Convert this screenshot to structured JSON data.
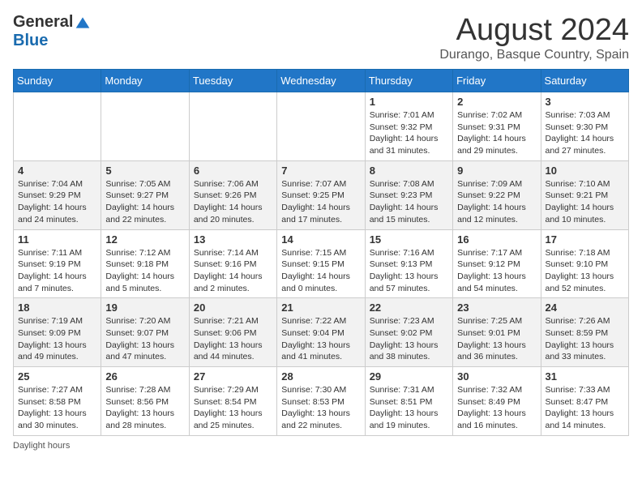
{
  "logo": {
    "general": "General",
    "blue": "Blue"
  },
  "title": "August 2024",
  "location": "Durango, Basque Country, Spain",
  "days_of_week": [
    "Sunday",
    "Monday",
    "Tuesday",
    "Wednesday",
    "Thursday",
    "Friday",
    "Saturday"
  ],
  "footer_note": "Daylight hours",
  "weeks": [
    [
      {
        "day": "",
        "detail": ""
      },
      {
        "day": "",
        "detail": ""
      },
      {
        "day": "",
        "detail": ""
      },
      {
        "day": "",
        "detail": ""
      },
      {
        "day": "1",
        "detail": "Sunrise: 7:01 AM\nSunset: 9:32 PM\nDaylight: 14 hours\nand 31 minutes."
      },
      {
        "day": "2",
        "detail": "Sunrise: 7:02 AM\nSunset: 9:31 PM\nDaylight: 14 hours\nand 29 minutes."
      },
      {
        "day": "3",
        "detail": "Sunrise: 7:03 AM\nSunset: 9:30 PM\nDaylight: 14 hours\nand 27 minutes."
      }
    ],
    [
      {
        "day": "4",
        "detail": "Sunrise: 7:04 AM\nSunset: 9:29 PM\nDaylight: 14 hours\nand 24 minutes."
      },
      {
        "day": "5",
        "detail": "Sunrise: 7:05 AM\nSunset: 9:27 PM\nDaylight: 14 hours\nand 22 minutes."
      },
      {
        "day": "6",
        "detail": "Sunrise: 7:06 AM\nSunset: 9:26 PM\nDaylight: 14 hours\nand 20 minutes."
      },
      {
        "day": "7",
        "detail": "Sunrise: 7:07 AM\nSunset: 9:25 PM\nDaylight: 14 hours\nand 17 minutes."
      },
      {
        "day": "8",
        "detail": "Sunrise: 7:08 AM\nSunset: 9:23 PM\nDaylight: 14 hours\nand 15 minutes."
      },
      {
        "day": "9",
        "detail": "Sunrise: 7:09 AM\nSunset: 9:22 PM\nDaylight: 14 hours\nand 12 minutes."
      },
      {
        "day": "10",
        "detail": "Sunrise: 7:10 AM\nSunset: 9:21 PM\nDaylight: 14 hours\nand 10 minutes."
      }
    ],
    [
      {
        "day": "11",
        "detail": "Sunrise: 7:11 AM\nSunset: 9:19 PM\nDaylight: 14 hours\nand 7 minutes."
      },
      {
        "day": "12",
        "detail": "Sunrise: 7:12 AM\nSunset: 9:18 PM\nDaylight: 14 hours\nand 5 minutes."
      },
      {
        "day": "13",
        "detail": "Sunrise: 7:14 AM\nSunset: 9:16 PM\nDaylight: 14 hours\nand 2 minutes."
      },
      {
        "day": "14",
        "detail": "Sunrise: 7:15 AM\nSunset: 9:15 PM\nDaylight: 14 hours\nand 0 minutes."
      },
      {
        "day": "15",
        "detail": "Sunrise: 7:16 AM\nSunset: 9:13 PM\nDaylight: 13 hours\nand 57 minutes."
      },
      {
        "day": "16",
        "detail": "Sunrise: 7:17 AM\nSunset: 9:12 PM\nDaylight: 13 hours\nand 54 minutes."
      },
      {
        "day": "17",
        "detail": "Sunrise: 7:18 AM\nSunset: 9:10 PM\nDaylight: 13 hours\nand 52 minutes."
      }
    ],
    [
      {
        "day": "18",
        "detail": "Sunrise: 7:19 AM\nSunset: 9:09 PM\nDaylight: 13 hours\nand 49 minutes."
      },
      {
        "day": "19",
        "detail": "Sunrise: 7:20 AM\nSunset: 9:07 PM\nDaylight: 13 hours\nand 47 minutes."
      },
      {
        "day": "20",
        "detail": "Sunrise: 7:21 AM\nSunset: 9:06 PM\nDaylight: 13 hours\nand 44 minutes."
      },
      {
        "day": "21",
        "detail": "Sunrise: 7:22 AM\nSunset: 9:04 PM\nDaylight: 13 hours\nand 41 minutes."
      },
      {
        "day": "22",
        "detail": "Sunrise: 7:23 AM\nSunset: 9:02 PM\nDaylight: 13 hours\nand 38 minutes."
      },
      {
        "day": "23",
        "detail": "Sunrise: 7:25 AM\nSunset: 9:01 PM\nDaylight: 13 hours\nand 36 minutes."
      },
      {
        "day": "24",
        "detail": "Sunrise: 7:26 AM\nSunset: 8:59 PM\nDaylight: 13 hours\nand 33 minutes."
      }
    ],
    [
      {
        "day": "25",
        "detail": "Sunrise: 7:27 AM\nSunset: 8:58 PM\nDaylight: 13 hours\nand 30 minutes."
      },
      {
        "day": "26",
        "detail": "Sunrise: 7:28 AM\nSunset: 8:56 PM\nDaylight: 13 hours\nand 28 minutes."
      },
      {
        "day": "27",
        "detail": "Sunrise: 7:29 AM\nSunset: 8:54 PM\nDaylight: 13 hours\nand 25 minutes."
      },
      {
        "day": "28",
        "detail": "Sunrise: 7:30 AM\nSunset: 8:53 PM\nDaylight: 13 hours\nand 22 minutes."
      },
      {
        "day": "29",
        "detail": "Sunrise: 7:31 AM\nSunset: 8:51 PM\nDaylight: 13 hours\nand 19 minutes."
      },
      {
        "day": "30",
        "detail": "Sunrise: 7:32 AM\nSunset: 8:49 PM\nDaylight: 13 hours\nand 16 minutes."
      },
      {
        "day": "31",
        "detail": "Sunrise: 7:33 AM\nSunset: 8:47 PM\nDaylight: 13 hours\nand 14 minutes."
      }
    ]
  ]
}
